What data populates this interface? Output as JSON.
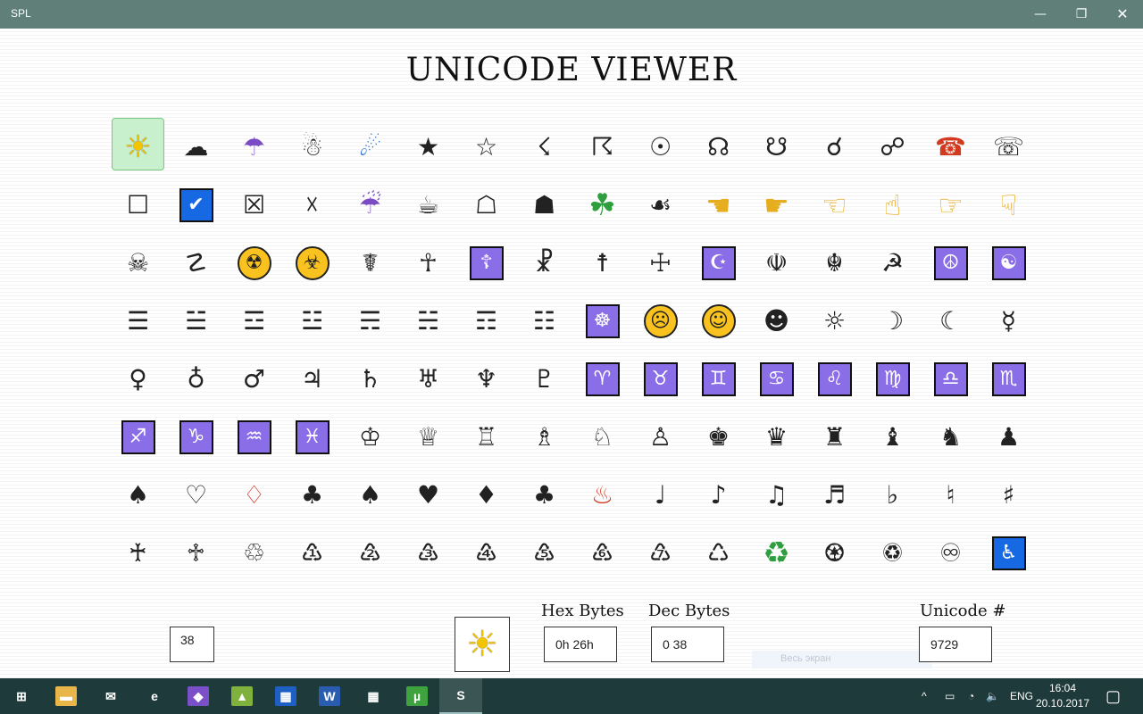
{
  "window": {
    "title": "SPL",
    "minimize": "—",
    "maximize": "❐",
    "close": "✕"
  },
  "page": {
    "title": "UNICODE VIEWER"
  },
  "grid": {
    "rows": [
      [
        {
          "char": "☀",
          "style": "color-sun",
          "selected": true
        },
        {
          "char": "☁"
        },
        {
          "char": "☂",
          "style": "color-purple"
        },
        {
          "char": "☃"
        },
        {
          "char": "☄",
          "style": "color-blue"
        },
        {
          "char": "★"
        },
        {
          "char": "☆"
        },
        {
          "char": "☇"
        },
        {
          "char": "☈"
        },
        {
          "char": "☉"
        },
        {
          "char": "☊"
        },
        {
          "char": "☋"
        },
        {
          "char": "☌"
        },
        {
          "char": "☍"
        },
        {
          "char": "☎",
          "style": "color-red"
        },
        {
          "char": "☏"
        }
      ],
      [
        {
          "char": "☐"
        },
        {
          "char": "✔",
          "style": "boxed-blue"
        },
        {
          "char": "☒"
        },
        {
          "char": "☓"
        },
        {
          "char": "☔",
          "style": "color-purple"
        },
        {
          "char": "☕"
        },
        {
          "char": "☖"
        },
        {
          "char": "☗"
        },
        {
          "char": "☘",
          "style": "color-green"
        },
        {
          "char": "☙"
        },
        {
          "char": "☚",
          "style": "color-hand"
        },
        {
          "char": "☛",
          "style": "color-hand"
        },
        {
          "char": "☜",
          "style": "color-hand"
        },
        {
          "char": "☝",
          "style": "color-hand"
        },
        {
          "char": "☞",
          "style": "color-hand"
        },
        {
          "char": "☟",
          "style": "color-hand"
        }
      ],
      [
        {
          "char": "☠"
        },
        {
          "char": "☡"
        },
        {
          "char": "☢",
          "style": "yellow-circle"
        },
        {
          "char": "☣",
          "style": "yellow-circle"
        },
        {
          "char": "☤"
        },
        {
          "char": "☥"
        },
        {
          "char": "☦",
          "style": "boxed"
        },
        {
          "char": "☧"
        },
        {
          "char": "☨"
        },
        {
          "char": "☩"
        },
        {
          "char": "☪",
          "style": "boxed"
        },
        {
          "char": "☫"
        },
        {
          "char": "☬"
        },
        {
          "char": "☭"
        },
        {
          "char": "☮",
          "style": "boxed"
        },
        {
          "char": "☯",
          "style": "boxed"
        }
      ],
      [
        {
          "char": "☰"
        },
        {
          "char": "☱"
        },
        {
          "char": "☲"
        },
        {
          "char": "☳"
        },
        {
          "char": "☴"
        },
        {
          "char": "☵"
        },
        {
          "char": "☶"
        },
        {
          "char": "☷"
        },
        {
          "char": "☸",
          "style": "boxed"
        },
        {
          "char": "☹",
          "style": "yellow-circle"
        },
        {
          "char": "☺",
          "style": "yellow-circle"
        },
        {
          "char": "☻"
        },
        {
          "char": "☼"
        },
        {
          "char": "☽"
        },
        {
          "char": "☾"
        },
        {
          "char": "☿"
        }
      ],
      [
        {
          "char": "♀"
        },
        {
          "char": "♁"
        },
        {
          "char": "♂"
        },
        {
          "char": "♃"
        },
        {
          "char": "♄"
        },
        {
          "char": "♅"
        },
        {
          "char": "♆"
        },
        {
          "char": "♇"
        },
        {
          "char": "♈",
          "style": "boxed"
        },
        {
          "char": "♉",
          "style": "boxed"
        },
        {
          "char": "♊",
          "style": "boxed"
        },
        {
          "char": "♋",
          "style": "boxed"
        },
        {
          "char": "♌",
          "style": "boxed"
        },
        {
          "char": "♍",
          "style": "boxed"
        },
        {
          "char": "♎",
          "style": "boxed"
        },
        {
          "char": "♏",
          "style": "boxed"
        }
      ],
      [
        {
          "char": "♐",
          "style": "boxed"
        },
        {
          "char": "♑",
          "style": "boxed"
        },
        {
          "char": "♒",
          "style": "boxed"
        },
        {
          "char": "♓",
          "style": "boxed"
        },
        {
          "char": "♔"
        },
        {
          "char": "♕"
        },
        {
          "char": "♖"
        },
        {
          "char": "♗"
        },
        {
          "char": "♘"
        },
        {
          "char": "♙"
        },
        {
          "char": "♚"
        },
        {
          "char": "♛"
        },
        {
          "char": "♜"
        },
        {
          "char": "♝"
        },
        {
          "char": "♞"
        },
        {
          "char": "♟"
        }
      ],
      [
        {
          "char": "♠"
        },
        {
          "char": "♡"
        },
        {
          "char": "♢",
          "style": "color-red"
        },
        {
          "char": "♣"
        },
        {
          "char": "♠"
        },
        {
          "char": "♥"
        },
        {
          "char": "♦"
        },
        {
          "char": "♣"
        },
        {
          "char": "♨",
          "style": "color-red"
        },
        {
          "char": "♩"
        },
        {
          "char": "♪"
        },
        {
          "char": "♫"
        },
        {
          "char": "♬"
        },
        {
          "char": "♭"
        },
        {
          "char": "♮"
        },
        {
          "char": "♯"
        }
      ],
      [
        {
          "char": "♰"
        },
        {
          "char": "♱"
        },
        {
          "char": "♲"
        },
        {
          "char": "♳"
        },
        {
          "char": "♴"
        },
        {
          "char": "♵"
        },
        {
          "char": "♶"
        },
        {
          "char": "♷"
        },
        {
          "char": "♸"
        },
        {
          "char": "♹"
        },
        {
          "char": "♺"
        },
        {
          "char": "♻",
          "style": "color-green"
        },
        {
          "char": "♼"
        },
        {
          "char": "♽"
        },
        {
          "char": "♾"
        },
        {
          "char": "♿",
          "style": "boxed-blue"
        }
      ]
    ]
  },
  "controls": {
    "index_value": "38",
    "preview_char": "☀",
    "hex_label": "Hex Bytes",
    "hex_value": "0h 26h",
    "dec_label": "Dec Bytes",
    "dec_value": "0 38",
    "unicode_label": "Unicode #",
    "unicode_value": "9729",
    "fullscreen_hint": "Весь экран"
  },
  "taskbar": {
    "apps": [
      {
        "name": "start-button",
        "glyph": "⊞",
        "bg": ""
      },
      {
        "name": "file-explorer-icon",
        "glyph": "▬",
        "bg": "#e9b64a"
      },
      {
        "name": "mail-icon",
        "glyph": "✉",
        "bg": ""
      },
      {
        "name": "edge-icon",
        "glyph": "e",
        "bg": ""
      },
      {
        "name": "visual-studio-icon",
        "glyph": "◆",
        "bg": "#7a4fc8"
      },
      {
        "name": "image-editor-icon",
        "glyph": "▲",
        "bg": "#7fb13c"
      },
      {
        "name": "film-icon",
        "glyph": "▦",
        "bg": "#1e5fc4"
      },
      {
        "name": "word-icon",
        "glyph": "W",
        "bg": "#2a5db0"
      },
      {
        "name": "calculator-icon",
        "glyph": "▦",
        "bg": ""
      },
      {
        "name": "utorrent-icon",
        "glyph": "µ",
        "bg": "#3ea33e"
      },
      {
        "name": "spl-app-icon",
        "glyph": "S",
        "bg": ""
      }
    ],
    "tray": {
      "language": "ENG",
      "time": "16:04",
      "date": "20.10.2017"
    },
    "tray_icons": [
      "^",
      "▭",
      "◔",
      "🔈"
    ],
    "notification_icon": "▢"
  },
  "colors": {
    "titlebar": "#5f7f78",
    "taskbar": "#1f3a3a",
    "selection": "#c9f0cd",
    "zodiac_box": "#8a6ee8"
  }
}
